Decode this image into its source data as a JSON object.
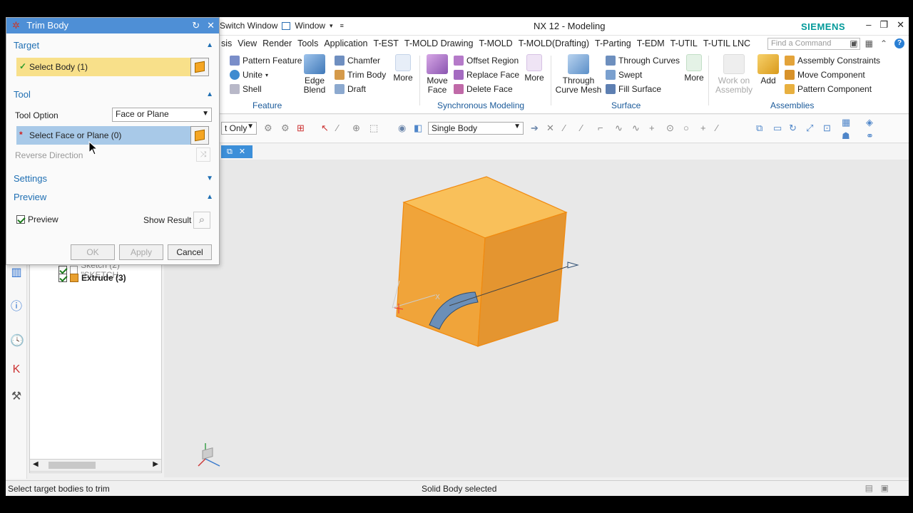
{
  "titlebar": {
    "quick_access": [
      "Switch Window",
      "Window"
    ],
    "app_title": "NX 12 - Modeling",
    "brand": "SIEMENS"
  },
  "menubar": {
    "items": [
      "sis",
      "View",
      "Render",
      "Tools",
      "Application",
      "T-EST",
      "T-MOLD Drawing",
      "T-MOLD",
      "T-MOLD(Drafting)",
      "T-Parting",
      "T-EDM",
      "T-UTIL",
      "T-UTIL LNC"
    ],
    "find_placeholder": "Find a Command"
  },
  "ribbon": {
    "feature": {
      "pattern_feature": "Pattern Feature",
      "unite": "Unite",
      "shell": "Shell",
      "edge_blend": "Edge Blend",
      "chamfer": "Chamfer",
      "trim_body": "Trim Body",
      "draft": "Draft",
      "more": "More",
      "group_label": "Feature"
    },
    "synchronous": {
      "move_face": "Move Face",
      "offset_region": "Offset Region",
      "replace_face": "Replace Face",
      "delete_face": "Delete Face",
      "more": "More",
      "group_label": "Synchronous Modeling"
    },
    "surface": {
      "through_curve_mesh": "Through Curve Mesh",
      "through_curves": "Through Curves",
      "swept": "Swept",
      "fill_surface": "Fill Surface",
      "more": "More",
      "group_label": "Surface"
    },
    "assemblies": {
      "work_on_assembly": "Work on Assembly",
      "add": "Add",
      "assembly_constraints": "Assembly Constraints",
      "move_component": "Move Component",
      "pattern_component": "Pattern Component",
      "group_label": "Assemblies"
    }
  },
  "toolbar": {
    "filter_value": "t Only",
    "body_filter": "Single Body"
  },
  "navigator": {
    "items": [
      {
        "label": "Sketch (2) \"SKETCH_",
        "checked": true
      },
      {
        "label": "Extrude (3)",
        "checked": true
      }
    ]
  },
  "dialog": {
    "title": "Trim Body",
    "target": {
      "section": "Target",
      "select_body": "Select Body (1)"
    },
    "tool": {
      "section": "Tool",
      "tool_option_label": "Tool Option",
      "tool_option_value": "Face or Plane",
      "select_face": "Select Face or Plane (0)",
      "reverse_direction": "Reverse Direction"
    },
    "settings": {
      "section": "Settings"
    },
    "preview": {
      "section": "Preview",
      "preview_label": "Preview",
      "show_result": "Show Result"
    },
    "buttons": {
      "ok": "OK",
      "apply": "Apply",
      "cancel": "Cancel"
    }
  },
  "statusbar": {
    "left": "Select target bodies to trim",
    "center": "Solid Body selected"
  },
  "colors": {
    "dialog_title": "#4e8fd6",
    "selected_field": "#f8e08a",
    "active_field": "#a8c9e8",
    "cube_face": "#f5a623",
    "siemens": "#009999"
  }
}
